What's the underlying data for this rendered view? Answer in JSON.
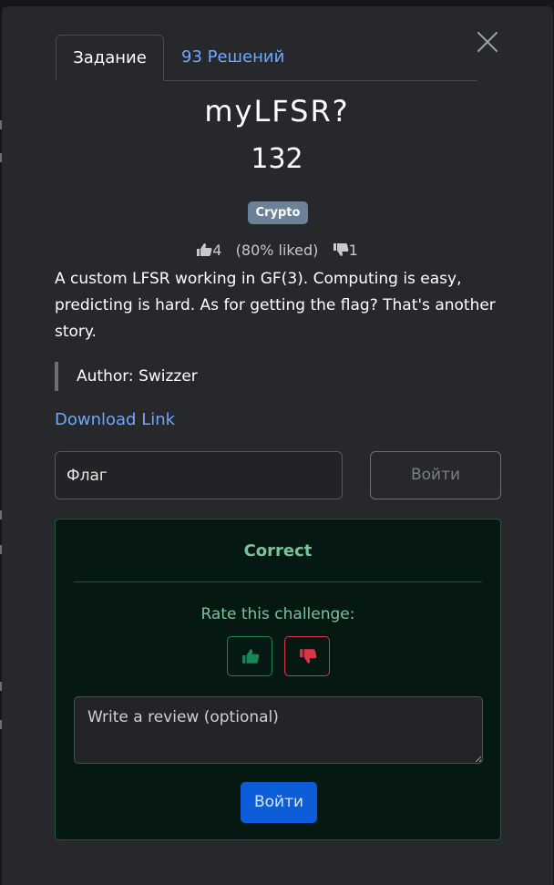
{
  "tabs": {
    "challenge_label": "Задание",
    "solves_label": "93 Решений"
  },
  "challenge": {
    "title": "myLFSR?",
    "points": "132",
    "category": "Crypto",
    "likes": "4",
    "liked_percent": "(80% liked)",
    "dislikes": "1",
    "description": "A custom LFSR working in GF(3). Computing is easy, predicting is hard. As for getting the flag? That's another story.",
    "author": "Author: Swizzer",
    "download_label": "Download Link"
  },
  "submission": {
    "flag_placeholder": "Флаг",
    "submit_label": "Войти"
  },
  "result": {
    "status": "Correct",
    "rate_label": "Rate this challenge:",
    "review_placeholder": "Write a review (optional)",
    "submit_label": "Войти"
  },
  "colors": {
    "accent_link": "#6ea8fe",
    "success_text": "#7ac29a",
    "success_border": "#198754",
    "danger_border": "#dc3545",
    "badge_bg": "#6c8097",
    "primary_button": "#0b5ed7"
  }
}
